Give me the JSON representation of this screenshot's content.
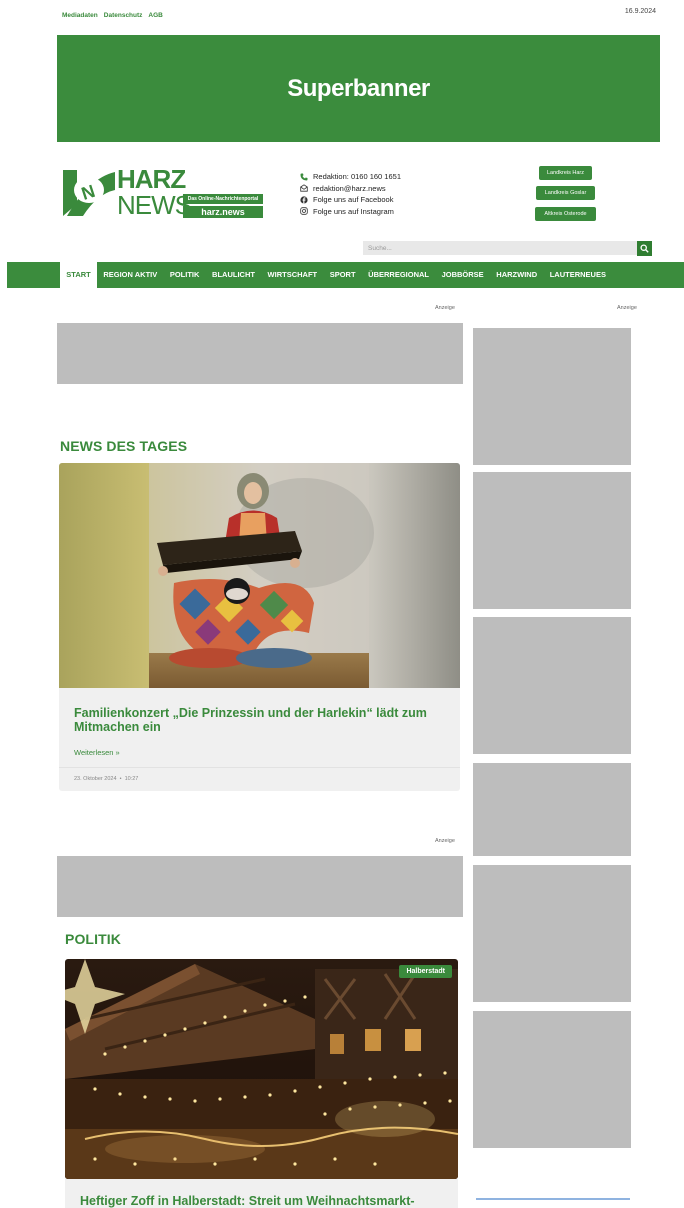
{
  "topbar": {
    "links": [
      "Mediadaten",
      "Datenschutz",
      "AGB"
    ],
    "date": "16.9.2024"
  },
  "superbanner": {
    "label": "Superbanner"
  },
  "logo": {
    "word1": "HARZ",
    "word2": "NEWS",
    "tagline": "Das Online-Nachrichtenportal",
    "domain": "harz.news"
  },
  "contact": {
    "phone": "Redaktion: 0160 160 1651",
    "email": "redaktion@harz.news",
    "facebook": "Folge uns auf Facebook",
    "instagram": "Folge uns auf Instagram"
  },
  "regions": [
    "Landkreis Harz",
    "Landkreis Goslar",
    "Altkreis Osterode"
  ],
  "search": {
    "placeholder": "Suche..."
  },
  "nav": {
    "items": [
      "START",
      "REGION AKTIV",
      "POLITIK",
      "BLAULICHT",
      "WIRTSCHAFT",
      "SPORT",
      "ÜBERREGIONAL",
      "JOBBÖRSE",
      "HARZWIND",
      "LAUTERNEUES"
    ],
    "active_index": 0
  },
  "ads": {
    "label": "Anzeige"
  },
  "news_section": {
    "title": "NEWS DES TAGES",
    "article": {
      "title": "Familienkonzert „Die Prinzessin und der Harlekin“ lädt zum Mitmachen ein",
      "read_more": "Weiterlesen »",
      "date": "23. Oktober 2024",
      "separator": "•",
      "time": "10:27"
    }
  },
  "politik_section": {
    "title": "POLITIK",
    "article": {
      "badge": "Halberstadt",
      "title": "Heftiger Zoff in Halberstadt: Streit um Weihnachtsmarkt-"
    }
  },
  "colors": {
    "brand_green": "#3b8c3d",
    "ad_gray": "#bdbdbd",
    "card_bg": "#f0f0f0"
  }
}
